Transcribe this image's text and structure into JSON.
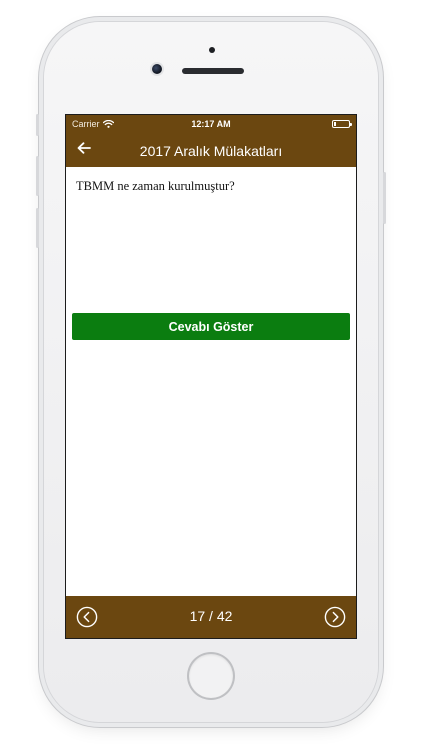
{
  "statusbar": {
    "carrier": "Carrier",
    "time": "12:17 AM",
    "battery_level": 0.15
  },
  "navbar": {
    "title": "2017 Aralık Mülakatları",
    "back_icon": "arrow-left-icon"
  },
  "content": {
    "question": "TBMM ne zaman kurulmuştur?",
    "answer_button_label": "Cevabı Göster"
  },
  "footer": {
    "page_indicator": "17 / 42",
    "prev_icon": "chevron-left-circle-icon",
    "next_icon": "chevron-right-circle-icon"
  },
  "colors": {
    "bar_brown": "#6b4710",
    "answer_green": "#0b7d10"
  }
}
